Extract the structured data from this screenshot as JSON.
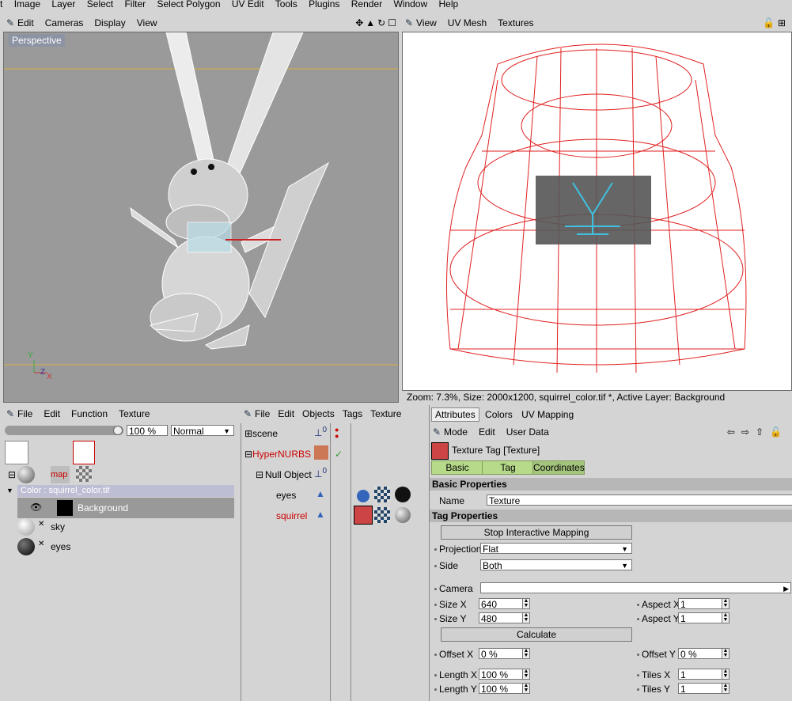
{
  "menubar": [
    "t",
    "Image",
    "Layer",
    "Select",
    "Filter",
    "Select Polygon",
    "UV Edit",
    "Tools",
    "Plugins",
    "Render",
    "Window",
    "Help"
  ],
  "viewport": {
    "menus": [
      "Edit",
      "Cameras",
      "Display",
      "View"
    ],
    "label": "Perspective",
    "axis_y": "Y",
    "axis_z": "Z",
    "axis_x": "X"
  },
  "uv": {
    "menus": [
      "View",
      "UV Mesh",
      "Textures"
    ],
    "status": "Zoom: 7.3%, Size: 2000x1200, squirrel_color.tif *, Active Layer: Background"
  },
  "materials": {
    "menus": [
      "File",
      "Edit",
      "Function",
      "Texture"
    ],
    "opacity": "100 %",
    "blend": "Normal",
    "map_label": "map",
    "layer_path": "Color : squirrel_color.tif",
    "layer_name": "Background",
    "sky": "sky",
    "eyes": "eyes"
  },
  "objects": {
    "menus": [
      "File",
      "Edit",
      "Objects",
      "Tags",
      "Texture"
    ],
    "items": [
      "scene",
      "HyperNURBS",
      "Null Object",
      "eyes",
      "squirrel"
    ],
    "zero": "0"
  },
  "attributes": {
    "tabs": [
      "Attributes",
      "Colors",
      "UV Mapping"
    ],
    "menus": [
      "Mode",
      "Edit",
      "User Data"
    ],
    "title": "Texture Tag [Texture]",
    "subtabs": [
      "Basic",
      "Tag",
      "Coordinates"
    ],
    "basic_props": "Basic Properties",
    "name_label": "Name",
    "name_value": "Texture",
    "tag_props": "Tag Properties",
    "stop_btn": "Stop Interactive Mapping",
    "projection_label": "Projection",
    "projection_value": "Flat",
    "side_label": "Side",
    "side_value": "Both",
    "camera_label": "Camera",
    "sizex_label": "Size X",
    "sizex_value": "640",
    "sizey_label": "Size Y",
    "sizey_value": "480",
    "aspectx_label": "Aspect X",
    "aspectx_value": "1",
    "aspecty_label": "Aspect Y",
    "aspecty_value": "1",
    "calc_btn": "Calculate",
    "offx_label": "Offset X",
    "offx_value": "0 %",
    "offy_label": "Offset Y",
    "offy_value": "0 %",
    "lenx_label": "Length X",
    "lenx_value": "100 %",
    "leny_label": "Length Y",
    "leny_value": "100 %",
    "tilesx_label": "Tiles X",
    "tilesx_value": "1",
    "tilesy_label": "Tiles Y",
    "tilesy_value": "1"
  },
  "colors": {
    "accent": "#cc0000",
    "viewport_bg": "#9a9a9a",
    "tab_green": "#b7d98a",
    "uv_wire": "#e02020",
    "uv_overlay": "#40c0e0"
  }
}
